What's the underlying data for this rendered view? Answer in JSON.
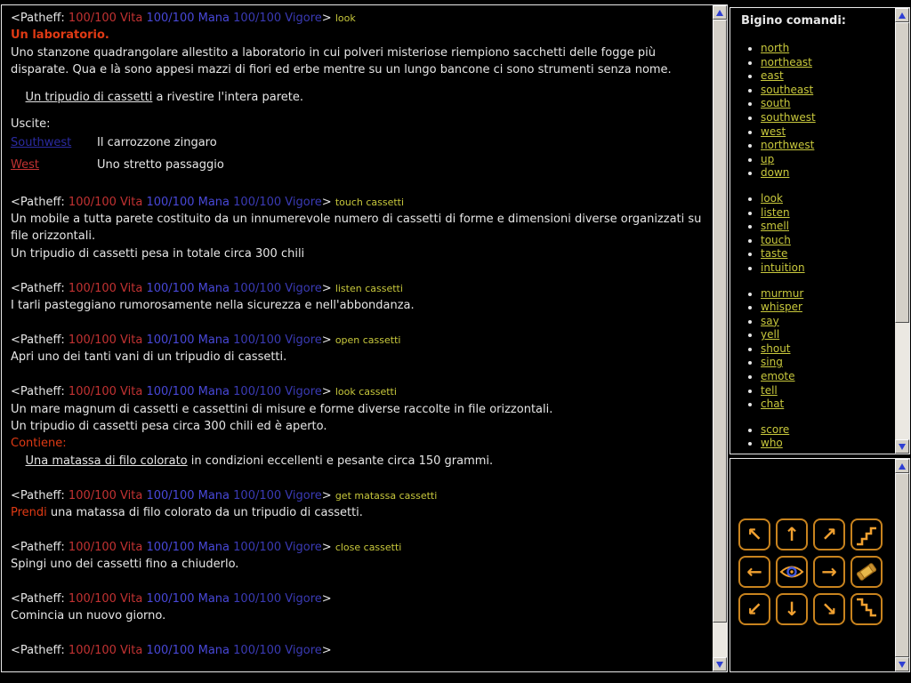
{
  "palette": {
    "background": "#000000",
    "text_white": "#e6e6e6",
    "vita_red": "#c23232",
    "mana_blue": "#4848d8",
    "vigore_blue": "#3a3ab4",
    "command_yellow": "#c8c83c",
    "title_red": "#e03a14",
    "exit_navy": "#2b2ba2",
    "exit_red": "#c23232",
    "button_orange": "#f0a030",
    "button_border_orange": "#c8831e",
    "scrollbar_arrow_blue": "#2f3fd3",
    "scrollbar_gray": "#d4d0c8"
  },
  "prompt": {
    "prefix": "<Patheff: ",
    "vita": "100/100 Vita",
    "mana": "100/100 Mana",
    "vigore": "100/100 Vigore",
    "suffix": "> "
  },
  "log": [
    {
      "p": "look"
    },
    {
      "seg": [
        {
          "t": "Un laboratorio.",
          "c": "title"
        }
      ]
    },
    {
      "seg": [
        {
          "t": "Uno stanzone quadrangolare allestito a laboratorio in cui polveri misteriose riempiono sacchetti delle fogge più disparate. Qua e là sono appesi mazzi di fiori ed erbe mentre su un lungo bancone ci sono strumenti senza nome.",
          "c": "txt"
        }
      ]
    },
    {
      "gap": 1
    },
    {
      "seg": [
        {
          "t": "    ",
          "c": "txt"
        },
        {
          "t": "Un tripudio di cassetti",
          "c": "link",
          "name": "object-link"
        },
        {
          "t": " a rivestire l'intera parete.",
          "c": "txt"
        }
      ]
    },
    {
      "gap": 1
    },
    {
      "seg": [
        {
          "t": "Uscite:",
          "c": "txt"
        }
      ]
    },
    {
      "exit": {
        "name": "Southwest",
        "cls": "navy",
        "desc": "Il carrozzone zingaro"
      }
    },
    {
      "exit": {
        "name": "West",
        "cls": "redlink",
        "desc": "Uno stretto passaggio"
      }
    },
    {
      "blank": 1
    },
    {
      "p": "touch cassetti"
    },
    {
      "seg": [
        {
          "t": "Un mobile a tutta parete costituito da un innumerevole numero di cassetti di forme e dimensioni diverse organizzati su file orizzontali.",
          "c": "txt"
        }
      ]
    },
    {
      "seg": [
        {
          "t": "Un tripudio di cassetti pesa in totale circa 300 chili",
          "c": "txt"
        }
      ]
    },
    {
      "blank": 1
    },
    {
      "p": "listen cassetti"
    },
    {
      "seg": [
        {
          "t": "I tarli pasteggiano rumorosamente nella sicurezza e nell'abbondanza.",
          "c": "txt"
        }
      ]
    },
    {
      "blank": 1
    },
    {
      "p": "open cassetti"
    },
    {
      "seg": [
        {
          "t": "Apri uno dei tanti vani di un tripudio di cassetti.",
          "c": "txt"
        }
      ]
    },
    {
      "blank": 1
    },
    {
      "p": "look cassetti"
    },
    {
      "seg": [
        {
          "t": "Un mare magnum di cassetti e cassettini di misure e forme diverse raccolte in file orizzontali.",
          "c": "txt"
        }
      ]
    },
    {
      "seg": [
        {
          "t": "Un tripudio di cassetti pesa circa 300 chili ed è aperto.",
          "c": "txt"
        }
      ]
    },
    {
      "seg": [
        {
          "t": "Contiene:",
          "c": "orange"
        }
      ]
    },
    {
      "seg": [
        {
          "t": "    ",
          "c": "txt"
        },
        {
          "t": "Una matassa di filo colorato",
          "c": "link",
          "name": "object-link"
        },
        {
          "t": " in condizioni eccellenti e pesante circa 150 grammi.",
          "c": "txt"
        }
      ]
    },
    {
      "blank": 1
    },
    {
      "p": "get matassa cassetti"
    },
    {
      "seg": [
        {
          "t": "Prendi",
          "c": "orange"
        },
        {
          "t": " una matassa di filo colorato da un tripudio di cassetti.",
          "c": "txt"
        }
      ]
    },
    {
      "blank": 1
    },
    {
      "p": "close cassetti"
    },
    {
      "seg": [
        {
          "t": "Spingi uno dei cassetti fino a chiuderlo.",
          "c": "txt"
        }
      ]
    },
    {
      "blank": 1
    },
    {
      "p": ""
    },
    {
      "seg": [
        {
          "t": "Comincia un nuovo giorno.",
          "c": "txt"
        }
      ]
    },
    {
      "blank": 1
    },
    {
      "p": ""
    }
  ],
  "commands_panel": {
    "title": "Bigino comandi:",
    "groups": [
      [
        "north",
        "northeast",
        "east",
        "southeast",
        "south",
        "southwest",
        "west",
        "northwest",
        "up",
        "down"
      ],
      [
        "look",
        "listen",
        "smell",
        "touch",
        "taste",
        "intuition"
      ],
      [
        "murmur",
        "whisper",
        "say",
        "yell",
        "shout",
        "sing",
        "emote",
        "tell",
        "chat"
      ],
      [
        "score",
        "who"
      ]
    ]
  },
  "nav_panel": {
    "rows": [
      [
        {
          "name": "northwest",
          "glyph": "↖"
        },
        {
          "name": "north",
          "glyph": "↑"
        },
        {
          "name": "northeast",
          "glyph": "↗"
        },
        {
          "name": "stairs-up",
          "icon": "stairs-up"
        }
      ],
      [
        {
          "name": "west",
          "glyph": "←"
        },
        {
          "name": "look",
          "icon": "eye"
        },
        {
          "name": "east",
          "glyph": "→"
        },
        {
          "name": "scroll",
          "icon": "scroll"
        }
      ],
      [
        {
          "name": "southwest",
          "glyph": "↙"
        },
        {
          "name": "south",
          "glyph": "↓"
        },
        {
          "name": "southeast",
          "glyph": "↘"
        },
        {
          "name": "stairs-down",
          "icon": "stairs-down"
        }
      ]
    ]
  }
}
